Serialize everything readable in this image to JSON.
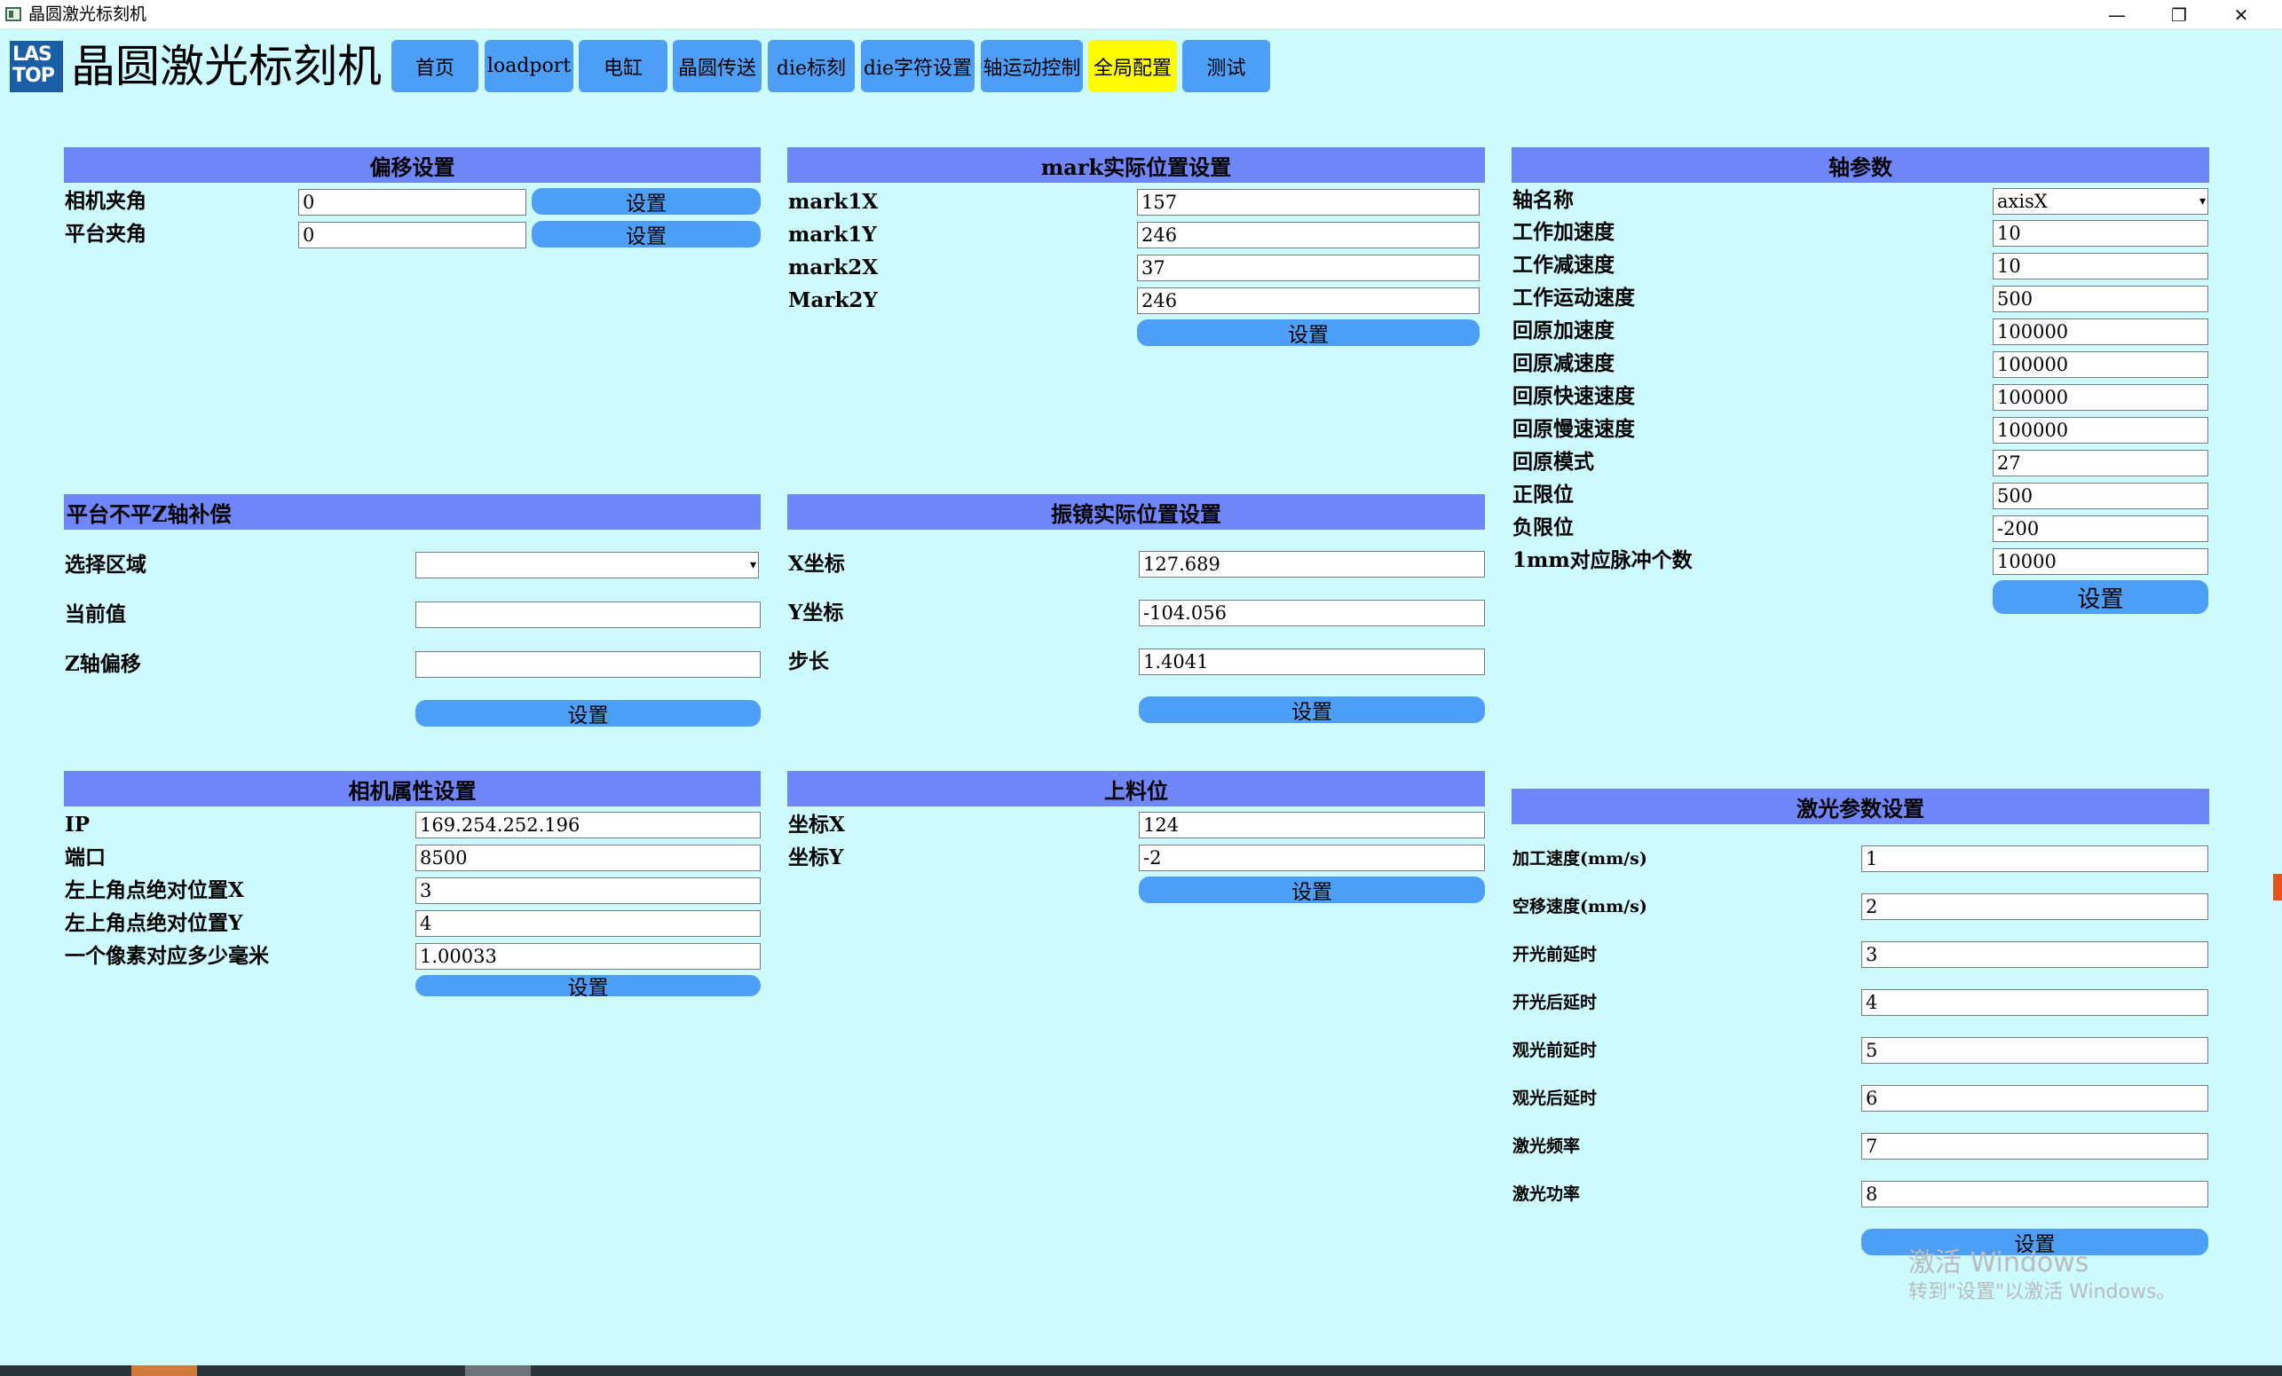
{
  "window": {
    "title": "晶圆激光标刻机",
    "min_glyph": "—",
    "restore_glyph": "❐",
    "close_glyph": "✕"
  },
  "logo": {
    "line1": "LAS",
    "line2": "TOP"
  },
  "app_title": "晶圆激光标刻机",
  "nav": {
    "active": "全局配置",
    "items": [
      "首页",
      "loadport",
      "电缸",
      "晶圆传送",
      "die标刻",
      "die字符设置",
      "轴运动控制",
      "全局配置",
      "测试"
    ]
  },
  "offset": {
    "title": "偏移设置",
    "camera_angle_label": "相机夹角",
    "camera_angle_value": "0",
    "platform_angle_label": "平台夹角",
    "platform_angle_value": "0",
    "set_label": "设置"
  },
  "mark": {
    "title": "mark实际位置设置",
    "rows": [
      {
        "label": "mark1X",
        "value": "157"
      },
      {
        "label": "mark1Y",
        "value": "246"
      },
      {
        "label": "mark2X",
        "value": "37"
      },
      {
        "label": "Mark2Y",
        "value": "246"
      }
    ],
    "set_label": "设置"
  },
  "axis": {
    "title": "轴参数",
    "name_label": "轴名称",
    "name_value": "axisX",
    "rows": [
      {
        "label": "工作加速度",
        "value": "10"
      },
      {
        "label": "工作减速度",
        "value": "10"
      },
      {
        "label": "工作运动速度",
        "value": "500"
      },
      {
        "label": "回原加速度",
        "value": "100000"
      },
      {
        "label": "回原减速度",
        "value": "100000"
      },
      {
        "label": "回原快速速度",
        "value": "100000"
      },
      {
        "label": "回原慢速速度",
        "value": "100000"
      },
      {
        "label": "回原模式",
        "value": "27"
      },
      {
        "label": "正限位",
        "value": "500"
      },
      {
        "label": "负限位",
        "value": "-200"
      },
      {
        "label": "1mm对应脉冲个数",
        "value": "10000"
      }
    ],
    "set_label": "设置"
  },
  "zcomp": {
    "title": "平台不平Z轴补偿",
    "region_label": "选择区域",
    "region_value": "",
    "current_label": "当前值",
    "current_value": "",
    "zoffset_label": "Z轴偏移",
    "zoffset_value": "",
    "set_label": "设置"
  },
  "galvo": {
    "title": "振镜实际位置设置",
    "x_label": "X坐标",
    "x_value": "127.689",
    "y_label": "Y坐标",
    "y_value": "-104.056",
    "step_label": "步长",
    "step_value": "1.4041",
    "set_label": "设置"
  },
  "camera": {
    "title": "相机属性设置",
    "rows": [
      {
        "label": "IP",
        "value": "169.254.252.196"
      },
      {
        "label": "端口",
        "value": "8500"
      },
      {
        "label": "左上角点绝对位置X",
        "value": "3"
      },
      {
        "label": "左上角点绝对位置Y",
        "value": "4"
      },
      {
        "label": "一个像素对应多少毫米",
        "value": "1.00033"
      }
    ],
    "set_label": "设置"
  },
  "loading": {
    "title": "上料位",
    "x_label": "坐标X",
    "x_value": "124",
    "y_label": "坐标Y",
    "y_value": "-2",
    "set_label": "设置"
  },
  "laser": {
    "title": "激光参数设置",
    "rows": [
      {
        "label": "加工速度(mm/s)",
        "value": "1"
      },
      {
        "label": "空移速度(mm/s)",
        "value": "2"
      },
      {
        "label": "开光前延时",
        "value": "3"
      },
      {
        "label": "开光后延时",
        "value": "4"
      },
      {
        "label": "观光前延时",
        "value": "5"
      },
      {
        "label": "观光后延时",
        "value": "6"
      },
      {
        "label": "激光频率",
        "value": "7"
      },
      {
        "label": "激光功率",
        "value": "8"
      }
    ],
    "set_label": "设置"
  },
  "watermark": {
    "line1": "激活 Windows",
    "line2": "转到\"设置\"以激活 Windows。"
  },
  "colors": {
    "background": "#ccfafd",
    "panel_header": "#6f86f9",
    "button": "#4d9ef6",
    "active_tab": "#fffb00",
    "logo": "#1a5fa6"
  }
}
